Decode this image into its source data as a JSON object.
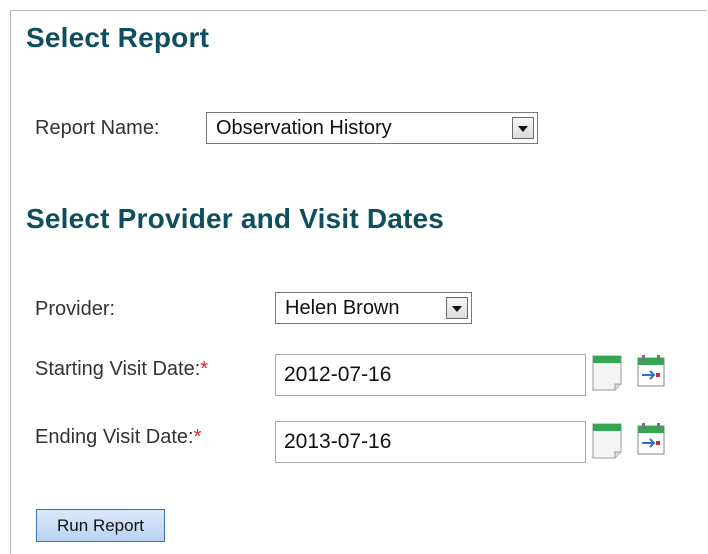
{
  "report_section": {
    "heading": "Select Report",
    "report_name_label": "Report Name:",
    "report_name_value": "Observation History"
  },
  "provider_section": {
    "heading": "Select Provider and Visit Dates",
    "provider_label": "Provider:",
    "provider_value": "Helen Brown",
    "start_label": "Starting Visit Date:",
    "start_value": "2012-07-16",
    "end_label": "Ending Visit Date:",
    "end_value": "2013-07-16",
    "required_marker": "*"
  },
  "actions": {
    "run_label": "Run Report"
  },
  "icons": {
    "calendar": "calendar-icon",
    "calendar_today": "calendar-today-icon"
  },
  "colors": {
    "heading": "#0d4f5c",
    "required": "#dd2222",
    "button_border": "#3c72a8"
  }
}
